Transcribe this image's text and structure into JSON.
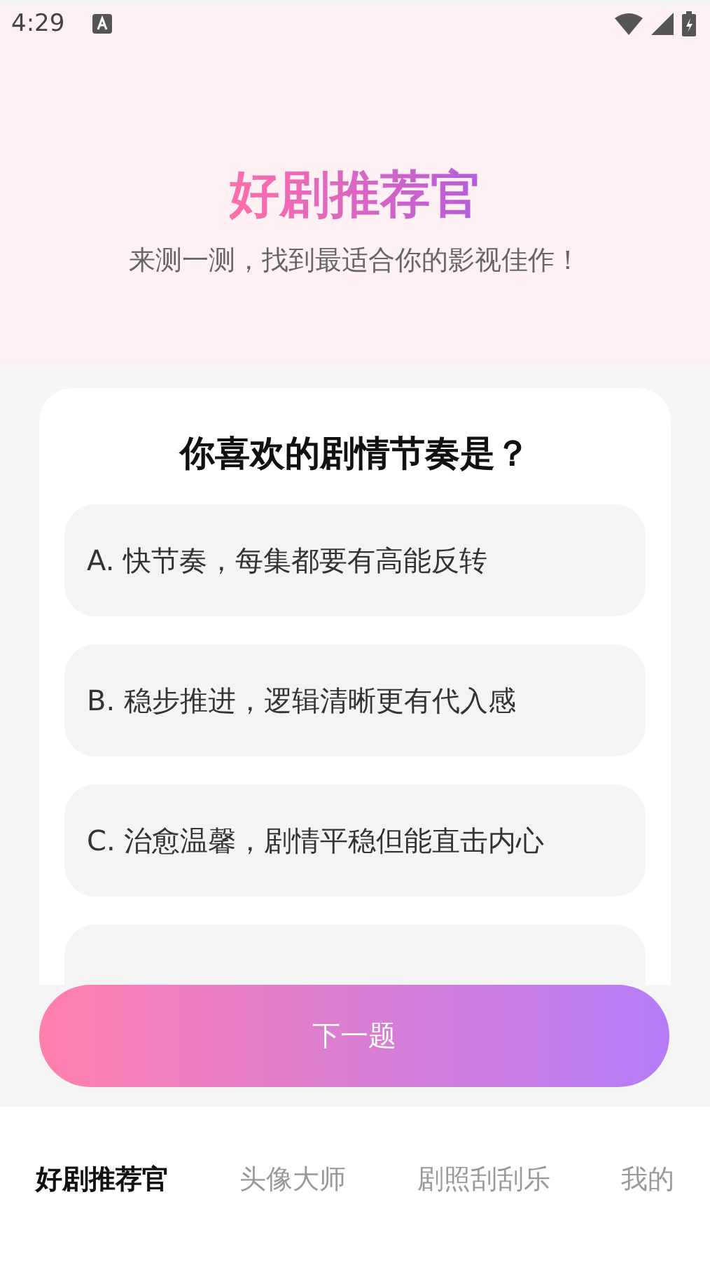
{
  "status_bar": {
    "time": "4:29"
  },
  "header": {
    "title": "好剧推荐官",
    "subtitle": "来测一测，找到最适合你的影视佳作！"
  },
  "question": {
    "text": "你喜欢的剧情节奏是？",
    "options": [
      {
        "label": "A. 快节奏，每集都要有高能反转",
        "selected": false
      },
      {
        "label": "B. 稳步推进，逻辑清晰更有代入感",
        "selected": false
      },
      {
        "label": "C. 治愈温馨，剧情平稳但能直击内心",
        "selected": false
      },
      {
        "selected": false
      }
    ]
  },
  "next_button": "下一题",
  "tabs": [
    {
      "label": "好剧推荐官",
      "selected": true
    },
    {
      "label": "头像大师",
      "selected": false
    },
    {
      "label": "剧照刮刮乐",
      "selected": false
    },
    {
      "label": "我的",
      "selected": false
    }
  ]
}
